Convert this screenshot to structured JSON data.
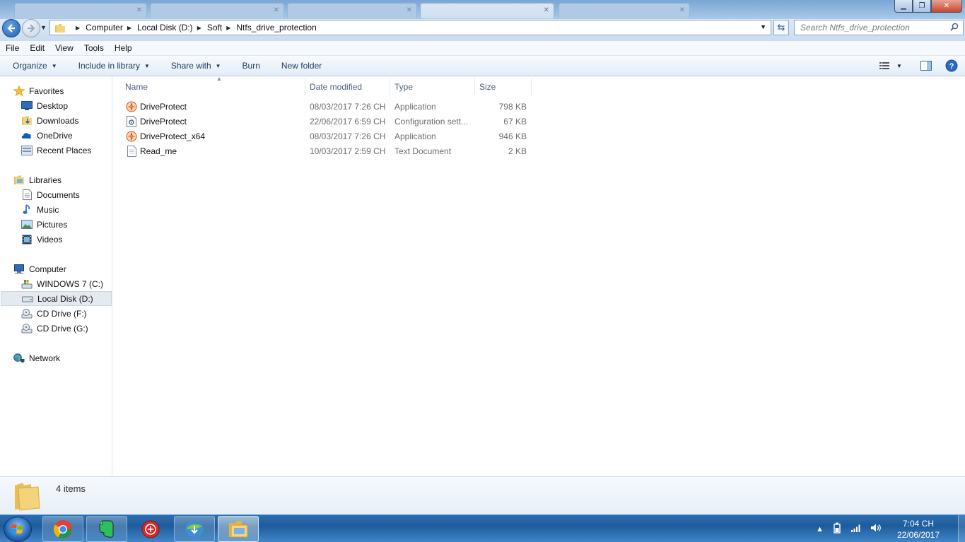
{
  "window": {
    "minimize_glyph": "▁",
    "maximize_glyph": "❐",
    "close_glyph": "✕"
  },
  "address": {
    "breadcrumbs": [
      "Computer",
      "Local Disk (D:)",
      "Soft",
      "Ntfs_drive_protection"
    ],
    "search_placeholder": "Search Ntfs_drive_protection"
  },
  "menu": [
    "File",
    "Edit",
    "View",
    "Tools",
    "Help"
  ],
  "commands": {
    "organize": "Organize",
    "include_in_library": "Include in library",
    "share_with": "Share with",
    "burn": "Burn",
    "new_folder": "New folder"
  },
  "nav": {
    "favorites": {
      "label": "Favorites",
      "items": [
        "Desktop",
        "Downloads",
        "OneDrive",
        "Recent Places"
      ]
    },
    "libraries": {
      "label": "Libraries",
      "items": [
        "Documents",
        "Music",
        "Pictures",
        "Videos"
      ]
    },
    "computer": {
      "label": "Computer",
      "items": [
        "WINDOWS 7 (C:)",
        "Local Disk (D:)",
        "CD Drive (F:)",
        "CD Drive (G:)"
      ],
      "selected": "Local Disk (D:)"
    },
    "network": {
      "label": "Network"
    }
  },
  "columns": [
    "Name",
    "Date modified",
    "Type",
    "Size"
  ],
  "files": [
    {
      "name": "DriveProtect",
      "date": "08/03/2017 7:26 CH",
      "type": "Application",
      "size": "798 KB",
      "icon": "application-icon"
    },
    {
      "name": "DriveProtect",
      "date": "22/06/2017 6:59 CH",
      "type": "Configuration sett...",
      "size": "67 KB",
      "icon": "config-file-icon"
    },
    {
      "name": "DriveProtect_x64",
      "date": "08/03/2017 7:26 CH",
      "type": "Application",
      "size": "946 KB",
      "icon": "application-icon"
    },
    {
      "name": "Read_me",
      "date": "10/03/2017 2:59 CH",
      "type": "Text Document",
      "size": "2 KB",
      "icon": "text-file-icon"
    }
  ],
  "status": {
    "items_count": "4 items"
  },
  "taskbar": {
    "apps": [
      "chrome-icon",
      "evernote-icon",
      "app-red-icon",
      "download-manager-icon",
      "explorer-icon"
    ],
    "clock_time": "7:04 CH",
    "clock_date": "22/06/2017"
  }
}
